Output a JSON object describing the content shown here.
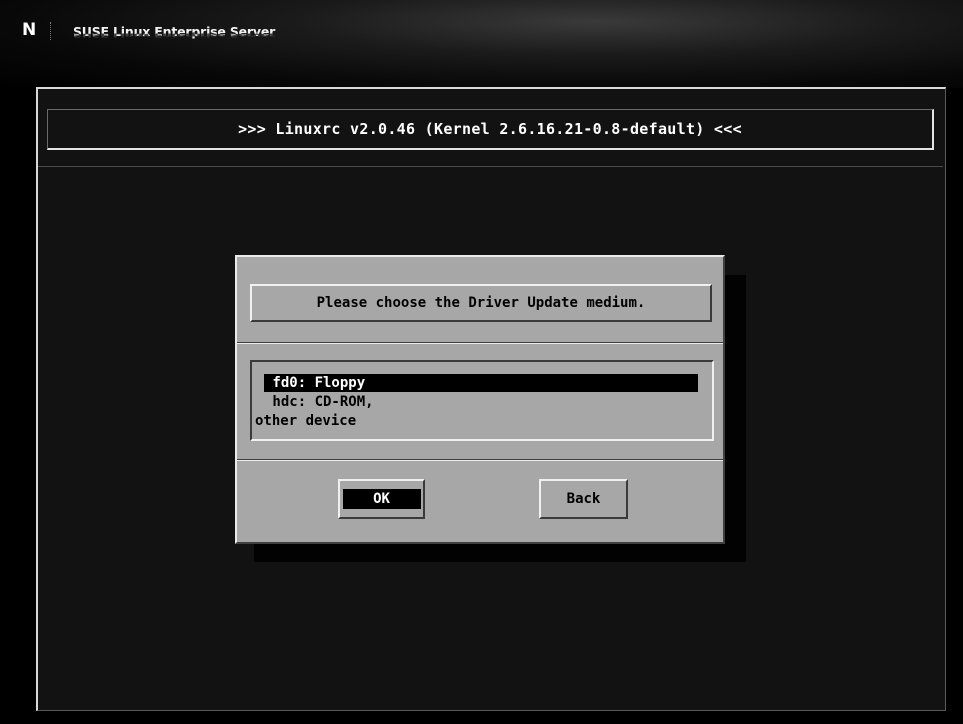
{
  "header": {
    "logo_letter": "N",
    "product": "SUSE Linux Enterprise Server"
  },
  "installer": {
    "title": ">>> Linuxrc v2.0.46 (Kernel 2.6.16.21-0.8-default) <<<"
  },
  "dialog": {
    "prompt": "Please choose the Driver Update medium.",
    "items": [
      {
        "label": " fd0: Floppy",
        "selected": true
      },
      {
        "label": " hdc: CD-ROM,",
        "selected": false
      },
      {
        "label": "other device",
        "selected": false
      }
    ],
    "ok_label": "OK",
    "back_label": "Back"
  },
  "colors": {
    "dialog_bg": "#a7a7a7",
    "screen_bg": "#121212",
    "selection_bg": "#000000",
    "selection_fg": "#ffffff"
  }
}
